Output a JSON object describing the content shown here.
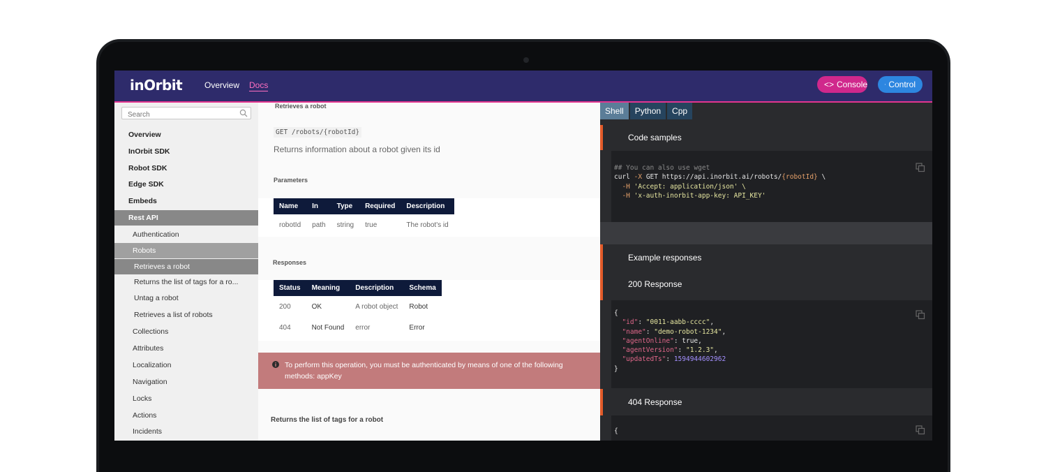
{
  "header": {
    "logo": "inOrbit",
    "nav": [
      "Overview",
      "Docs"
    ],
    "console_label": "Console",
    "control_label": "Control"
  },
  "sidebar": {
    "search_placeholder": "Search",
    "items": [
      {
        "label": "Overview",
        "level": "top"
      },
      {
        "label": "InOrbit SDK",
        "level": "top"
      },
      {
        "label": "Robot SDK",
        "level": "top"
      },
      {
        "label": "Edge SDK",
        "level": "top"
      },
      {
        "label": "Embeds",
        "level": "top"
      },
      {
        "label": "Rest API",
        "level": "top"
      },
      {
        "label": "Authentication",
        "level": "sub"
      },
      {
        "label": "Robots",
        "level": "sub"
      },
      {
        "label": "Retrieves a robot",
        "level": "subsub"
      },
      {
        "label": "Returns the list of tags for a ro...",
        "level": "subsub"
      },
      {
        "label": "Untag a robot",
        "level": "subsub"
      },
      {
        "label": "Retrieves a list of robots",
        "level": "subsub"
      },
      {
        "label": "Collections",
        "level": "sub"
      },
      {
        "label": "Attributes",
        "level": "sub"
      },
      {
        "label": "Localization",
        "level": "sub"
      },
      {
        "label": "Navigation",
        "level": "sub"
      },
      {
        "label": "Locks",
        "level": "sub"
      },
      {
        "label": "Actions",
        "level": "sub"
      },
      {
        "label": "Incidents",
        "level": "sub"
      }
    ]
  },
  "content": {
    "section_title": "Retrieves a robot",
    "endpoint": "GET /robots/{robotId}",
    "description": "Returns information about a robot given its id",
    "parameters_heading": "Parameters",
    "parameters_columns": [
      "Name",
      "In",
      "Type",
      "Required",
      "Description"
    ],
    "parameters_rows": [
      [
        "robotId",
        "path",
        "string",
        "true",
        "The robot's id"
      ]
    ],
    "responses_heading": "Responses",
    "responses_columns": [
      "Status",
      "Meaning",
      "Description",
      "Schema"
    ],
    "responses_rows": [
      [
        "200",
        "OK",
        "A robot object",
        "Robot"
      ],
      [
        "404",
        "Not Found",
        "error",
        "Error"
      ]
    ],
    "warning": "To perform this operation, you must be authenticated by means of one of the following methods: appKey",
    "next_section_title": "Returns the list of tags for a robot"
  },
  "code": {
    "tabs": [
      "Shell",
      "Python",
      "Cpp"
    ],
    "code_samples_heading": "Code samples",
    "curl_comment": "## You can also use wget",
    "curl_cmd": "curl",
    "curl_flag_x": "-X",
    "curl_method_url": "GET https://api.inorbit.ai/robots/",
    "curl_param": "{robotId}",
    "curl_cont": "\\",
    "curl_h1_flag": "-H",
    "curl_h1_val": "'Accept: application/json' \\",
    "curl_h2_flag": "-H",
    "curl_h2_val": "'x-auth-inorbit-app-key: API_KEY'",
    "example_heading": "Example responses",
    "resp200_heading": "200 Response",
    "resp404_heading": "404 Response",
    "json_open": "{",
    "json_close": "}",
    "json_fields": [
      {
        "key": "\"id\"",
        "value": "\"0011-aabb-cccc\"",
        "kind": "str"
      },
      {
        "key": "\"name\"",
        "value": "\"demo-robot-1234\"",
        "kind": "str"
      },
      {
        "key": "\"agentOnline\"",
        "value": "true",
        "kind": "plain"
      },
      {
        "key": "\"agentVersion\"",
        "value": "\"1.2.3\"",
        "kind": "str"
      },
      {
        "key": "\"updatedTs\"",
        "value": "1594944602962",
        "kind": "num"
      }
    ]
  },
  "colors": {
    "header_bg": "#2e2b6b",
    "accent_pink": "#e3358f",
    "console_btn": "#d0288c",
    "control_btn": "#2d86e0",
    "table_header": "#0e1a3a",
    "warning_bg": "#c27b7c",
    "code_accent": "#e35b2a"
  }
}
